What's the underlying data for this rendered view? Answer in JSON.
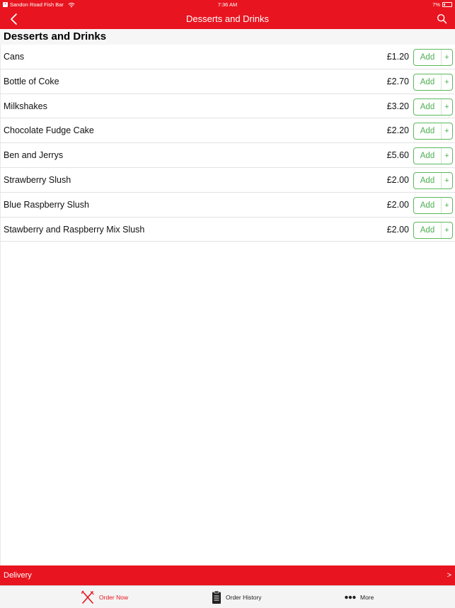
{
  "status_bar": {
    "back_app": "Sandon Road Fish Bar",
    "time": "7:36 AM",
    "battery": "7%"
  },
  "nav": {
    "title": "Desserts and Drinks"
  },
  "section": {
    "title": "Desserts and Drinks"
  },
  "items": [
    {
      "name": "Cans",
      "price": "£1.20",
      "add_label": "Add",
      "plus": "+"
    },
    {
      "name": "Bottle of Coke",
      "price": "£2.70",
      "add_label": "Add",
      "plus": "+"
    },
    {
      "name": "Milkshakes",
      "price": "£3.20",
      "add_label": "Add",
      "plus": "+"
    },
    {
      "name": "Chocolate Fudge Cake",
      "price": "£2.20",
      "add_label": "Add",
      "plus": "+"
    },
    {
      "name": "Ben and Jerrys",
      "price": "£5.60",
      "add_label": "Add",
      "plus": "+"
    },
    {
      "name": "Strawberry Slush",
      "price": "£2.00",
      "add_label": "Add",
      "plus": "+"
    },
    {
      "name": "Blue Raspberry Slush",
      "price": "£2.00",
      "add_label": "Add",
      "plus": "+"
    },
    {
      "name": "Stawberry and Raspberry Mix Slush",
      "price": "£2.00",
      "add_label": "Add",
      "plus": "+"
    }
  ],
  "delivery": {
    "label": "Delivery",
    "arrow": ">"
  },
  "tabs": {
    "order_now": "Order Now",
    "order_history": "Order History",
    "more": "More"
  },
  "colors": {
    "brand_red": "#e8141f",
    "add_green": "#4caf50"
  },
  "icons": {
    "nav_back": "chevron-left-icon",
    "nav_search": "search-icon",
    "order_now": "fork-knife-icon",
    "order_history": "clipboard-icon",
    "more": "ellipsis-icon"
  }
}
